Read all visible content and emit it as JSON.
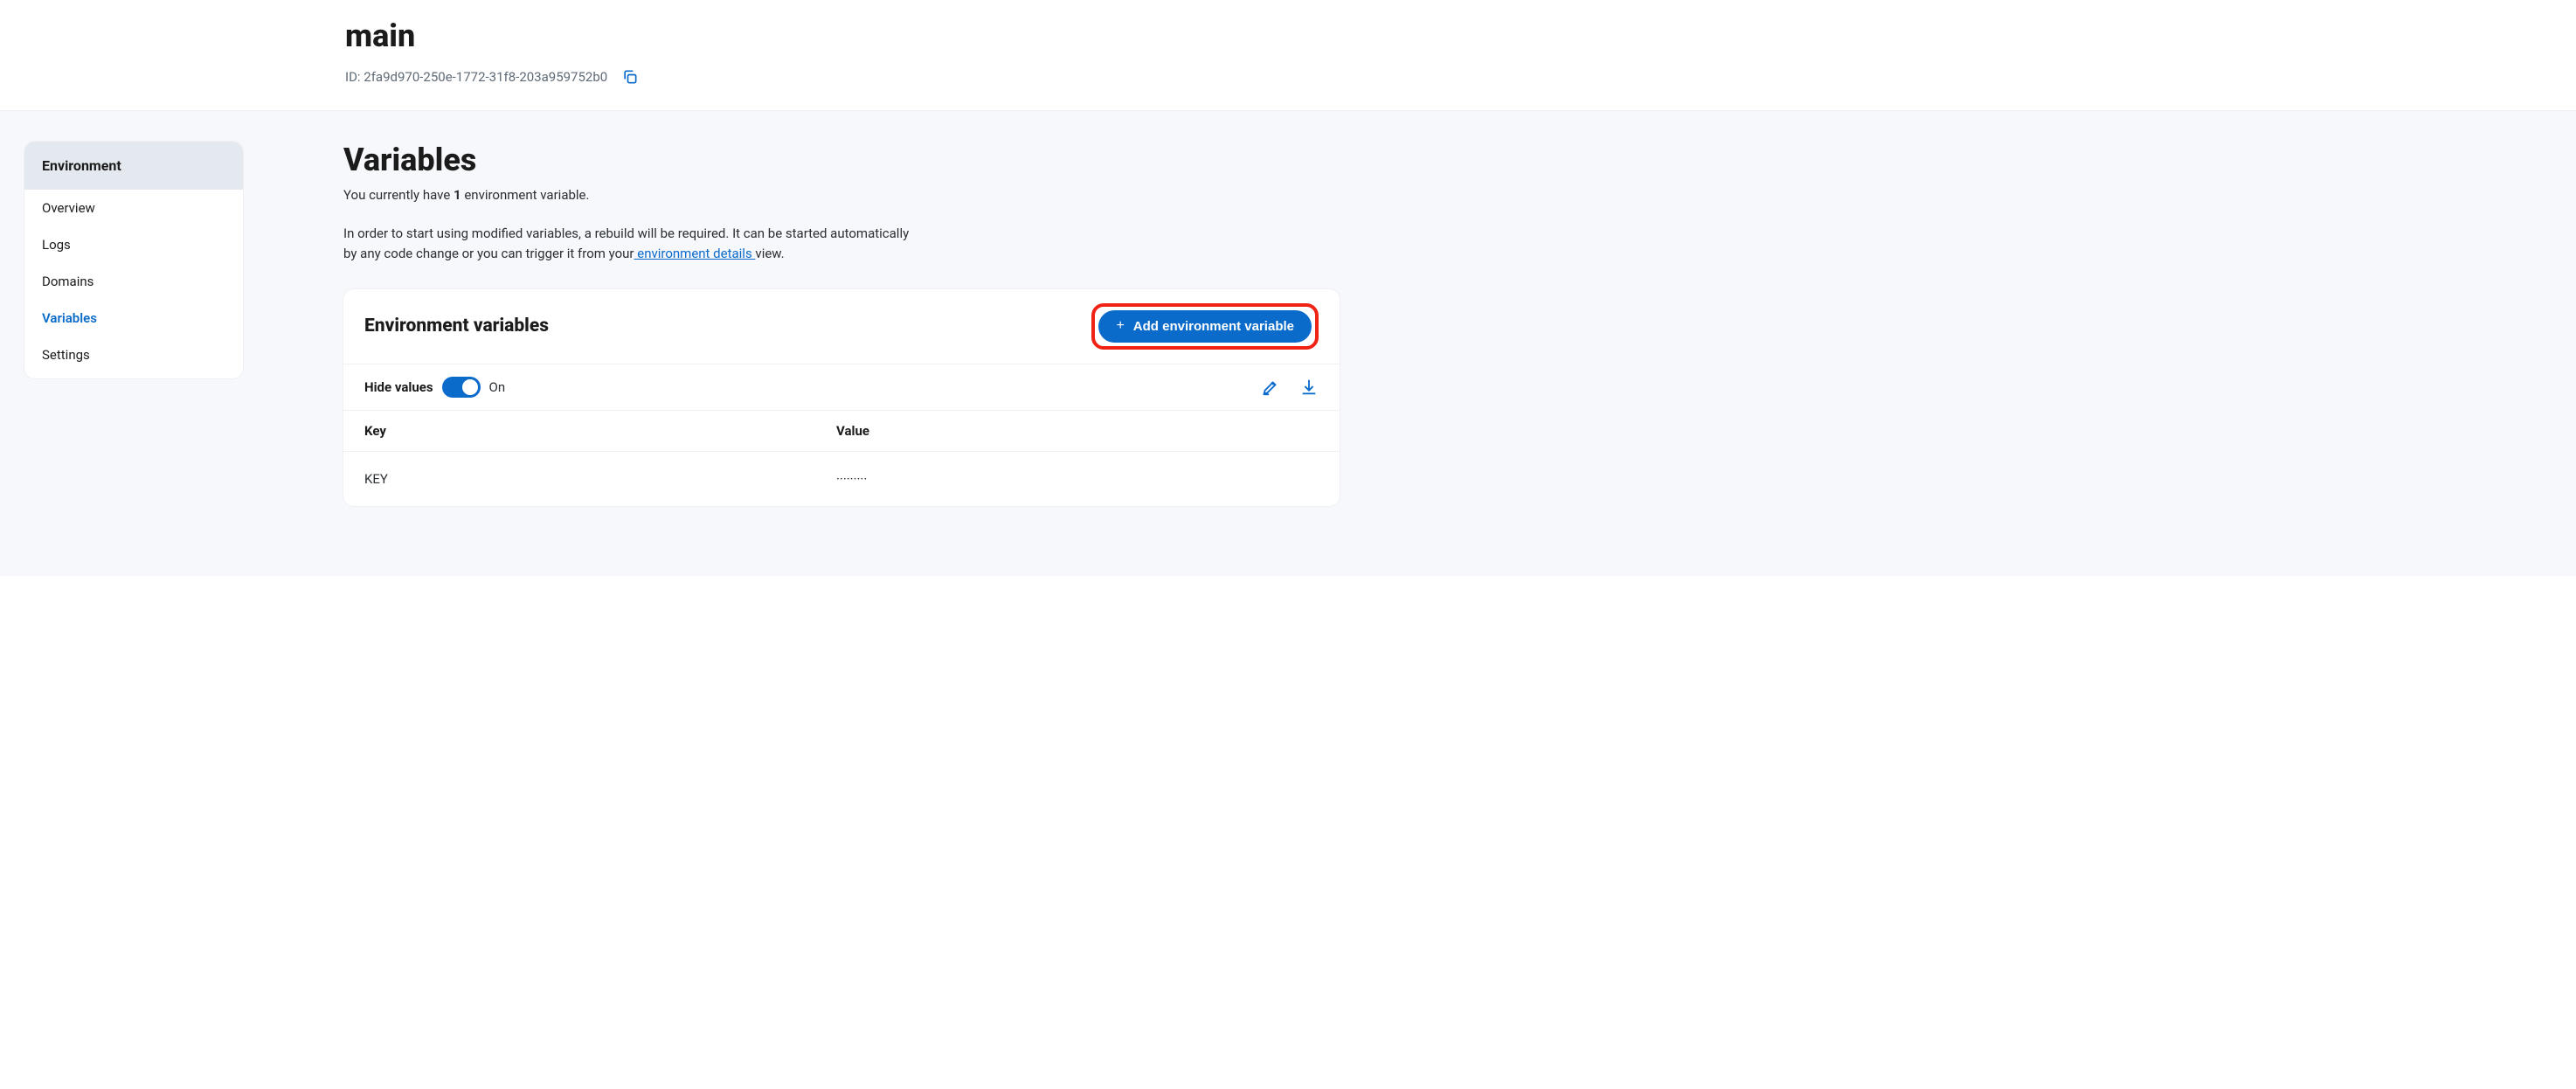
{
  "header": {
    "title": "main",
    "id_prefix": "ID: ",
    "id_value": "2fa9d970-250e-1772-31f8-203a959752b0"
  },
  "sidebar": {
    "header": "Environment",
    "items": [
      {
        "label": "Overview",
        "active": false
      },
      {
        "label": "Logs",
        "active": false
      },
      {
        "label": "Domains",
        "active": false
      },
      {
        "label": "Variables",
        "active": true
      },
      {
        "label": "Settings",
        "active": false
      }
    ]
  },
  "main": {
    "title": "Variables",
    "subtitle_prefix": "You currently have ",
    "subtitle_count": "1",
    "subtitle_suffix": " environment variable.",
    "info_prefix": "In order to start using modified variables, a rebuild will be required. It can be started automatically by any code change or you can trigger it from your",
    "info_link": " environment details ",
    "info_suffix": "view."
  },
  "card": {
    "title": "Environment variables",
    "add_button_label": "Add environment variable",
    "hide_values_label": "Hide values",
    "toggle_state": "On",
    "columns": {
      "key": "Key",
      "value": "Value"
    },
    "rows": [
      {
        "key": "KEY",
        "value": "·········"
      }
    ]
  }
}
